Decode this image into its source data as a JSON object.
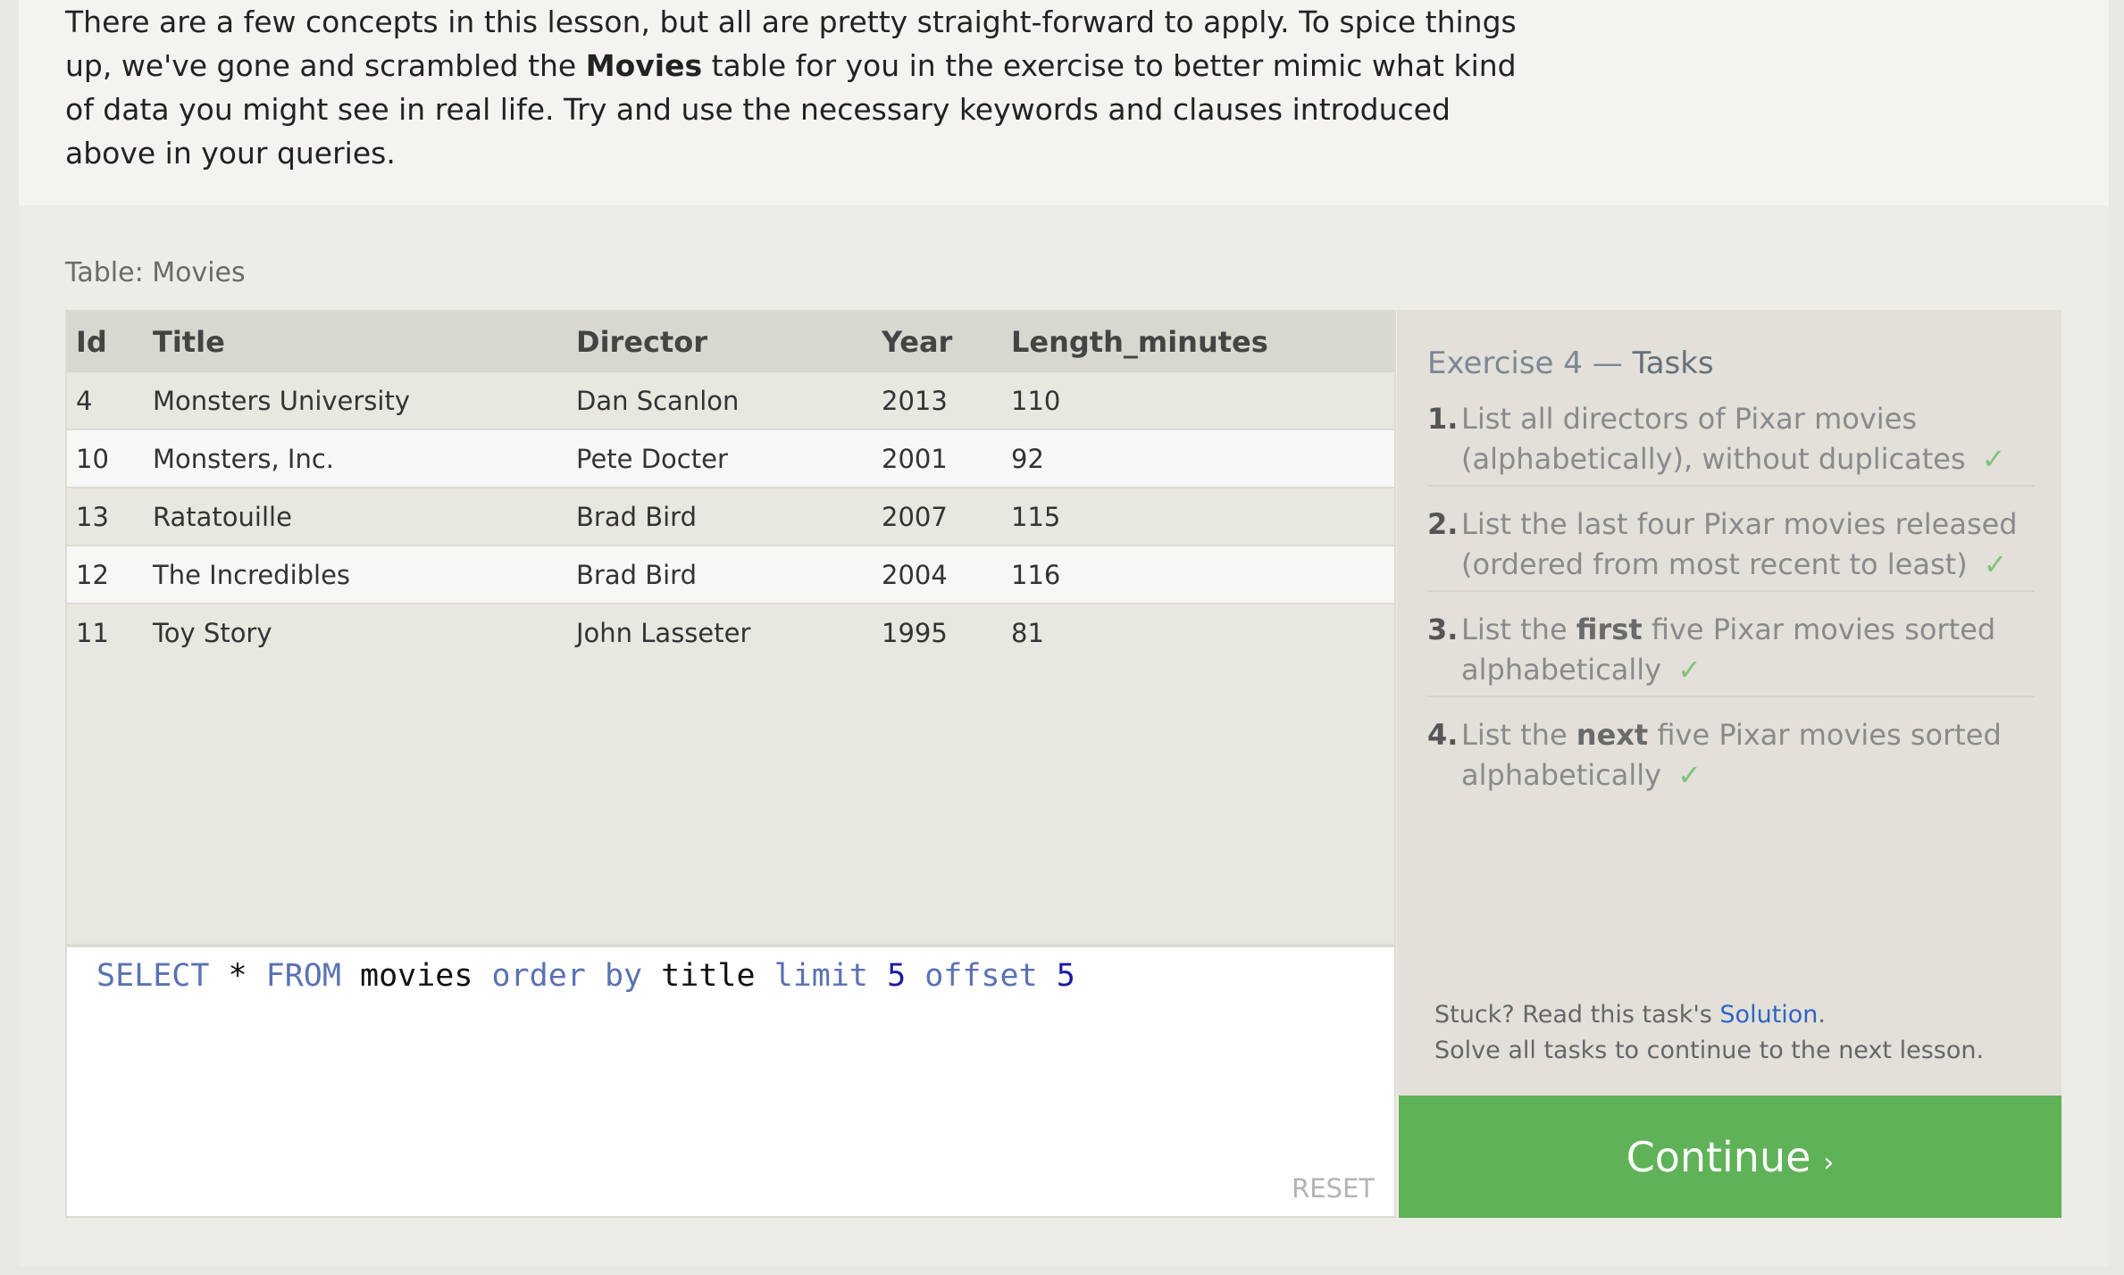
{
  "intro": {
    "text_before": "There are a few concepts in this lesson, but all are pretty straight-forward to apply. To spice things up, we've gone and scrambled the ",
    "bold": "Movies",
    "text_after": " table for you in the exercise to better mimic what kind of data you might see in real life. Try and use the necessary keywords and clauses introduced above in your queries."
  },
  "table": {
    "label": "Table: Movies",
    "columns": [
      "Id",
      "Title",
      "Director",
      "Year",
      "Length_minutes"
    ],
    "rows": [
      [
        "4",
        "Monsters University",
        "Dan Scanlon",
        "2013",
        "110"
      ],
      [
        "10",
        "Monsters, Inc.",
        "Pete Docter",
        "2001",
        "92"
      ],
      [
        "13",
        "Ratatouille",
        "Brad Bird",
        "2007",
        "115"
      ],
      [
        "12",
        "The Incredibles",
        "Brad Bird",
        "2004",
        "116"
      ],
      [
        "11",
        "Toy Story",
        "John Lasseter",
        "1995",
        "81"
      ]
    ]
  },
  "editor": {
    "tokens": [
      {
        "text": "SELECT",
        "type": "kw"
      },
      {
        "text": " * ",
        "type": "plain"
      },
      {
        "text": "FROM",
        "type": "kw"
      },
      {
        "text": " movies ",
        "type": "plain"
      },
      {
        "text": "order by",
        "type": "kw"
      },
      {
        "text": " title ",
        "type": "plain"
      },
      {
        "text": "limit",
        "type": "kw"
      },
      {
        "text": " ",
        "type": "plain"
      },
      {
        "text": "5",
        "type": "num"
      },
      {
        "text": " ",
        "type": "plain"
      },
      {
        "text": "offset",
        "type": "kw"
      },
      {
        "text": " ",
        "type": "plain"
      },
      {
        "text": "5",
        "type": "num"
      }
    ],
    "reset_label": "RESET"
  },
  "tasks": {
    "title_prefix": "Exercise 4 — ",
    "title_em": "Tasks",
    "items": [
      {
        "num": "1.",
        "parts": [
          {
            "t": "List all directors of Pixar movies (alphabetically), without duplicates",
            "b": false
          }
        ],
        "done": true
      },
      {
        "num": "2.",
        "parts": [
          {
            "t": "List the last four Pixar movies released (ordered from most recent to least)",
            "b": false
          }
        ],
        "done": true
      },
      {
        "num": "3.",
        "parts": [
          {
            "t": "List the ",
            "b": false
          },
          {
            "t": "first",
            "b": true
          },
          {
            "t": " five Pixar movies sorted alphabetically",
            "b": false
          }
        ],
        "done": true
      },
      {
        "num": "4.",
        "parts": [
          {
            "t": "List the ",
            "b": false
          },
          {
            "t": "next",
            "b": true
          },
          {
            "t": " five Pixar movies sorted alphabetically",
            "b": false
          }
        ],
        "done": true
      }
    ],
    "check_glyph": "✓",
    "stuck_prefix": "Stuck? Read this task's ",
    "solution_link": "Solution",
    "stuck_suffix": ".",
    "solve_all": "Solve all tasks to continue to the next lesson."
  },
  "continue": {
    "label": "Continue",
    "arrow": "›"
  },
  "colors": {
    "continue_green": "#5fb257",
    "keyword_blue": "#5a72b3",
    "number_blue": "#1a1aa6",
    "check_green": "#7fc27a",
    "link_blue": "#2f64c6"
  }
}
